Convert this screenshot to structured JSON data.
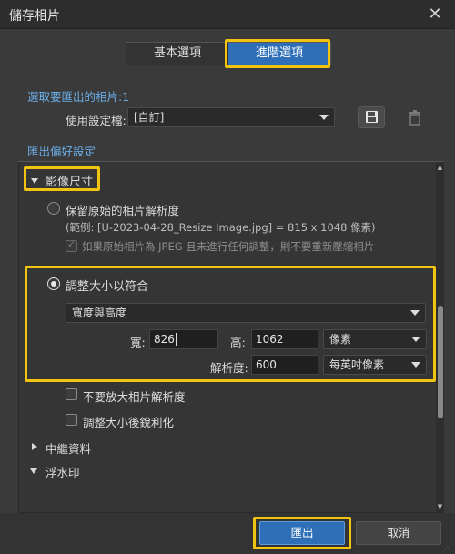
{
  "window": {
    "title": "儲存相片",
    "close_label": "✕"
  },
  "tabs": [
    {
      "label": "基本選項",
      "active": false
    },
    {
      "label": "進階選項",
      "active": true
    }
  ],
  "selected_photos": "選取要匯出的相片:1",
  "preset": {
    "label": "使用設定檔:",
    "value": "[自訂]",
    "save_icon": "floppy-disk-icon",
    "delete_icon": "trash-icon"
  },
  "export_prefs_heading": "匯出偏好設定",
  "image_size": {
    "section_label": "影像尺寸",
    "keep_original": {
      "label": "保留原始的相片解析度",
      "example": "(範例: [U-2023-04-28_Resize Image.jpg] = 815 x 1048 像素)",
      "no_recompress": "如果原始相片為 JPEG 且未進行任何調整，則不要重新壓縮相片"
    },
    "resize_to_fit": {
      "label": "調整大小以符合",
      "mode": "寬度與高度",
      "width_label": "寬:",
      "width_value": "826",
      "height_label": "高:",
      "height_value": "1062",
      "unit": "像素",
      "resolution_label": "解析度:",
      "resolution_value": "600",
      "resolution_unit": "每英吋像素"
    },
    "dont_enlarge": "不要放大相片解析度",
    "sharpen_after": "調整大小後銳利化"
  },
  "metadata_label": "中繼資料",
  "watermark_label": "浮水印",
  "buttons": {
    "export": "匯出",
    "cancel": "取消"
  },
  "colors": {
    "accent": "#2e6fb8",
    "highlight": "#f2c40f",
    "link": "#6aaee8"
  }
}
